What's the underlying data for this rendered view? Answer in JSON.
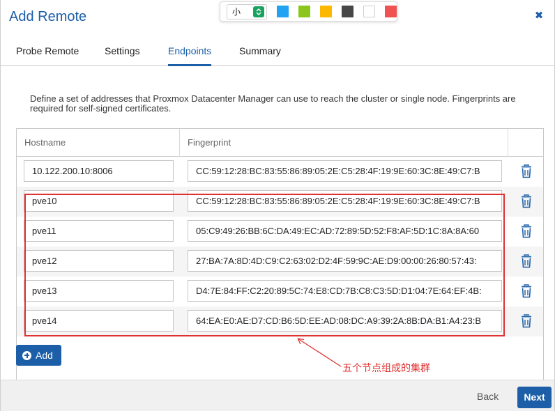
{
  "dialog": {
    "title": "Add Remote"
  },
  "annotation_toolbar": {
    "font_size_value": "小",
    "swatches": [
      {
        "name": "blue",
        "color": "#21a3f1"
      },
      {
        "name": "green",
        "color": "#8dc51f"
      },
      {
        "name": "yellow",
        "color": "#fcb800"
      },
      {
        "name": "dark-gray",
        "color": "#474747"
      },
      {
        "name": "white",
        "color": "#ffffff"
      },
      {
        "name": "red",
        "color": "#f05252"
      }
    ]
  },
  "tabs": [
    {
      "label": "Probe Remote",
      "active": false
    },
    {
      "label": "Settings",
      "active": false
    },
    {
      "label": "Endpoints",
      "active": true
    },
    {
      "label": "Summary",
      "active": false
    }
  ],
  "description": "Define a set of addresses that Proxmox Datacenter Manager can use to reach the cluster or single node. Fingerprints are required for self-signed certificates.",
  "table": {
    "columns": [
      "Hostname",
      "Fingerprint",
      ""
    ],
    "rows": [
      {
        "hostname": "10.122.200.10:8006",
        "fingerprint": "CC:59:12:28:BC:83:55:86:89:05:2E:C5:28:4F:19:9E:60:3C:8E:49:C7:B"
      },
      {
        "hostname": "pve10",
        "fingerprint": "CC:59:12:28:BC:83:55:86:89:05:2E:C5:28:4F:19:9E:60:3C:8E:49:C7:B"
      },
      {
        "hostname": "pve11",
        "fingerprint": "05:C9:49:26:BB:6C:DA:49:EC:AD:72:89:5D:52:F8:AF:5D:1C:8A:8A:60"
      },
      {
        "hostname": "pve12",
        "fingerprint": "27:BA:7A:8D:4D:C9:C2:63:02:D2:4F:59:9C:AE:D9:00:00:26:80:57:43:"
      },
      {
        "hostname": "pve13",
        "fingerprint": "D4:7E:84:FF:C2:20:89:5C:74:E8:CD:7B:C8:C3:5D:D1:04:7E:64:EF:4B:"
      },
      {
        "hostname": "pve14",
        "fingerprint": "64:EA:E0:AE:D7:CD:B6:5D:EE:AD:08:DC:A9:39:2A:8B:DA:B1:A4:23:B"
      }
    ]
  },
  "add_button_label": "Add",
  "annotation_note": "五个节点组成的集群",
  "footer": {
    "back_label": "Back",
    "next_label": "Next"
  },
  "colors": {
    "accent": "#1c5fa8",
    "annotation": "#e03131"
  }
}
